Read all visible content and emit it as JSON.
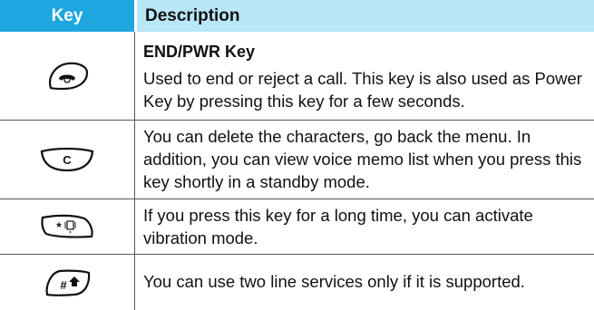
{
  "header": {
    "key": "Key",
    "description": "Description"
  },
  "rows": [
    {
      "icon": "end-power-key-icon",
      "title": "END/PWR Key",
      "text": "Used to end or reject a call. This key is also used as Power Key by pressing this key for a few seconds."
    },
    {
      "icon": "clear-key-icon",
      "icon_label": "C",
      "text": "You can delete the characters, go back the menu. In addition, you can view voice memo list when you press this key shortly in a standby mode."
    },
    {
      "icon": "star-vibrate-key-icon",
      "text": "If you press this key for a long time, you can activate vibration mode."
    },
    {
      "icon": "hash-line-key-icon",
      "text": "You can use two line services only if it is supported."
    }
  ]
}
